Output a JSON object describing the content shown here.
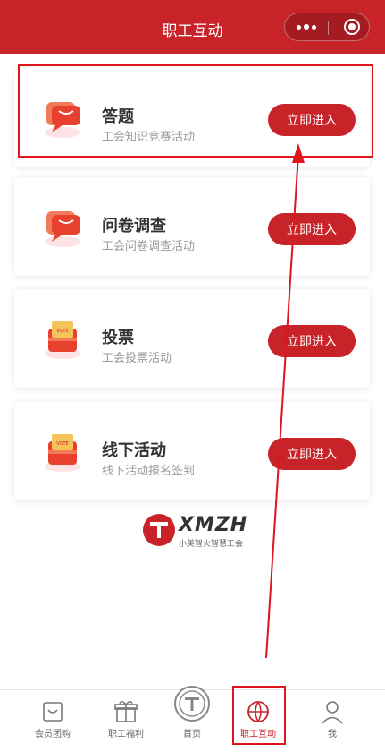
{
  "header": {
    "title": "职工互动"
  },
  "cards": [
    {
      "title": "答题",
      "desc": "工会知识竞赛活动",
      "button": "立即进入",
      "icon": "chat-bubble-icon"
    },
    {
      "title": "问卷调查",
      "desc": "工会问卷调查活动",
      "button": "立即进入",
      "icon": "chat-bubble-icon"
    },
    {
      "title": "投票",
      "desc": "工会投票活动",
      "button": "立即进入",
      "icon": "vote-box-icon"
    },
    {
      "title": "线下活动",
      "desc": "线下活动报名签到",
      "button": "立即进入",
      "icon": "vote-box-icon"
    }
  ],
  "logo": {
    "text": "XMZH",
    "subtitle": "小美智火智慧工会"
  },
  "tabbar": {
    "items": [
      {
        "label": "会员团购",
        "icon": "shopping-bag-icon"
      },
      {
        "label": "职工福利",
        "icon": "gift-icon"
      },
      {
        "label": "首页",
        "icon": "union-emblem-icon"
      },
      {
        "label": "职工互动",
        "icon": "basketball-icon"
      },
      {
        "label": "我",
        "icon": "user-icon"
      }
    ],
    "active_index": 3
  },
  "colors": {
    "brand": "#c9232a",
    "annotation": "#e0141c"
  }
}
